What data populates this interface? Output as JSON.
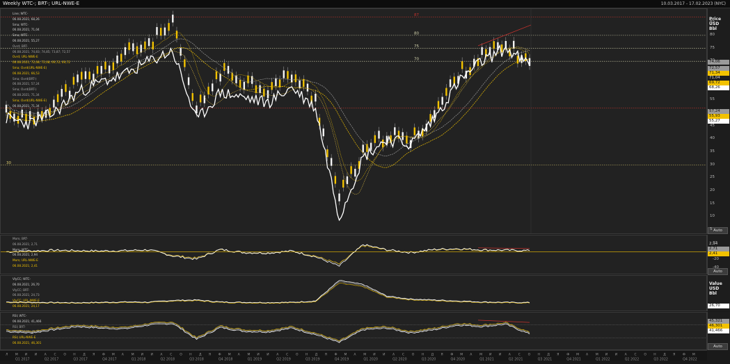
{
  "window": {
    "title": "Weekly WTC-; BRT-; URL-NWE-E",
    "range": "10.03.2017 - 17.02.2023 (NYC)"
  },
  "colors": {
    "gold": "#f2c200",
    "white": "#ffffff",
    "red": "#c8322d",
    "grey": "#9a9a9a",
    "bg": "#222222"
  },
  "main_axis": {
    "title_lines": [
      "Price",
      "USD",
      "Bbl"
    ],
    "ticks": [
      "85",
      "80",
      "75",
      "70",
      "65",
      "60",
      "55",
      "50",
      "45",
      "40",
      "35",
      "30",
      "25",
      "20",
      "15",
      "10",
      "5"
    ],
    "auto": "Auto",
    "tags": [
      {
        "text": "74,06",
        "style": "grey"
      },
      {
        "text": "72,57",
        "style": "grey"
      },
      {
        "text": "71,34",
        "style": "gold"
      },
      {
        "text": "71,04",
        "style": "dark"
      },
      {
        "text": "69,72",
        "style": "gold"
      },
      {
        "text": "68,26",
        "style": "white"
      },
      {
        "text": "57,24",
        "style": "grey"
      },
      {
        "text": "55,93",
        "style": "gold"
      },
      {
        "text": "55,27",
        "style": "white"
      }
    ]
  },
  "levels": [
    {
      "label": "87",
      "value": 87,
      "color": "#c8322d"
    },
    {
      "label": "80",
      "value": 80,
      "color": "#d8d8b0"
    },
    {
      "label": "75",
      "value": 75,
      "color": "#d8d8b0"
    },
    {
      "label": "70",
      "value": 70,
      "color": "#d8d8b0"
    },
    {
      "label": "",
      "value": 52,
      "color": "#c8322d"
    },
    {
      "label": "30",
      "value": 30,
      "color": "#e0d070"
    }
  ],
  "main_legend": [
    {
      "t": "Line; WTC-",
      "c": ""
    },
    {
      "t": "06.08.2021; 68,26",
      "c": ""
    },
    {
      "t": "Sma; WTC-",
      "c": ""
    },
    {
      "t": "06.08.2021; 71,04",
      "c": ""
    },
    {
      "t": "Sma; WTC-",
      "c": ""
    },
    {
      "t": "06.08.2021; 55,27",
      "c": ""
    },
    {
      "t": "Ovrd; BRT-",
      "c": "g"
    },
    {
      "t": "06.08.2021; 74,83; 74,85; 73,87; 72,57",
      "c": "g"
    },
    {
      "t": "Ovrd; URL-NWE-E",
      "c": "y"
    },
    {
      "t": "06.08.2021; 72,08; 72,08; 69,72; 69,72",
      "c": "y"
    },
    {
      "t": "Sma; Ovrd(URL-NWE-E)",
      "c": "y"
    },
    {
      "t": "06.08.2021; 66,53",
      "c": "y"
    },
    {
      "t": "Sma; Ovrd(BRT-)",
      "c": "g"
    },
    {
      "t": "06.08.2021; 57,24",
      "c": "g"
    },
    {
      "t": "Sma; Ovrd(BRT-)",
      "c": "g"
    },
    {
      "t": "06.08.2021; 71,34",
      "c": "g"
    },
    {
      "t": "Sma; Ovrd(URL-NWE-E)",
      "c": "y"
    },
    {
      "t": "06.08.2021; 71,34",
      "c": ""
    }
  ],
  "mom_pane": {
    "legend": [
      {
        "t": "Mom; BRT-",
        "c": "g"
      },
      {
        "t": "06.08.2021; 2,71",
        "c": "g"
      },
      {
        "t": "Mom; WTC-",
        "c": ""
      },
      {
        "t": "06.08.2021; 2,94",
        "c": ""
      },
      {
        "t": "Mom; URL-NWE-E",
        "c": "y"
      },
      {
        "t": "06.08.2021; 2,41",
        "c": "y"
      }
    ],
    "ticks": [
      "20",
      "0",
      "-20",
      "-40"
    ],
    "tags": [
      {
        "text": "2,94",
        "style": "dark"
      },
      {
        "text": "2,71",
        "style": "grey"
      },
      {
        "text": "2,41",
        "style": "gold"
      }
    ],
    "auto": "Auto"
  },
  "vol_pane": {
    "legend": [
      {
        "t": "VlyCC; WTC-",
        "c": ""
      },
      {
        "t": "06.08.2021; 26,70",
        "c": ""
      },
      {
        "t": "VlyCC; BRT-",
        "c": "g"
      },
      {
        "t": "06.08.2021; 24,73",
        "c": "g"
      },
      {
        "t": "VlyCC; URL-NWE-E",
        "c": "y"
      },
      {
        "t": "06.08.2021; 24,17",
        "c": "y"
      }
    ],
    "title_lines": [
      "Value",
      "USD",
      "Bbl"
    ],
    "tags": [
      {
        "text": "26,70",
        "style": "white"
      }
    ],
    "auto": "Auto"
  },
  "rsi_pane": {
    "legend": [
      {
        "t": "RSI; WTC-",
        "c": ""
      },
      {
        "t": "06.08.2021; 41,466",
        "c": ""
      },
      {
        "t": "RSI; BRT-",
        "c": "g"
      },
      {
        "t": "06.08.2021; 45,321",
        "c": "g"
      },
      {
        "t": "RSI; URL-NWE-E",
        "c": "y"
      },
      {
        "t": "06.08.2021; 46,301",
        "c": "y"
      }
    ],
    "tags": [
      {
        "text": "45,321",
        "style": "grey"
      },
      {
        "text": "46,301",
        "style": "gold"
      },
      {
        "text": "41,466",
        "style": "white"
      }
    ],
    "auto": "Auto"
  },
  "date_axis": {
    "months": [
      "Л",
      "М",
      "И",
      "И",
      "А",
      "С",
      "О",
      "Н",
      "Д",
      "Я",
      "Ф",
      "М",
      "А",
      "М",
      "И",
      "И",
      "А",
      "С",
      "О",
      "Н",
      "Д",
      "Я",
      "Ф",
      "М",
      "А",
      "М",
      "И",
      "И",
      "А",
      "С",
      "О",
      "Н",
      "Д",
      "Я",
      "Ф",
      "М",
      "А",
      "М",
      "И",
      "И",
      "А",
      "С",
      "О",
      "Н",
      "Д",
      "Я",
      "Ф",
      "М",
      "А",
      "М",
      "И",
      "И",
      "А",
      "С",
      "О",
      "Н",
      "Д",
      "Я",
      "Ф",
      "М",
      "А",
      "М",
      "И",
      "И",
      "А",
      "С",
      "О",
      "Н",
      "Д",
      "Я",
      "Ф",
      "М"
    ],
    "quarters": [
      "Q1 2017",
      "Q2 2017",
      "Q3 2017",
      "Q4 2017",
      "Q1 2018",
      "Q2 2018",
      "Q3 2018",
      "Q4 2018",
      "Q1 2019",
      "Q2 2019",
      "Q3 2019",
      "Q4 2019",
      "Q1 2020",
      "Q2 2020",
      "Q3 2020",
      "Q4 2020",
      "Q1 2021",
      "Q2 2021",
      "Q3 2021",
      "Q4 2021",
      "Q1 2022",
      "Q2 2022",
      "Q3 2022",
      "Q4 2022",
      "Q1 2023"
    ]
  },
  "chart_data": {
    "type": "line",
    "title": "Weekly WTC-; BRT-; URL-NWE-E",
    "ylabel": "Price USD Bbl",
    "ylim": [
      5,
      88
    ],
    "x": [
      "2017-03",
      "2017-06",
      "2017-09",
      "2017-12",
      "2018-03",
      "2018-06",
      "2018-09",
      "2018-10",
      "2018-12",
      "2019-03",
      "2019-06",
      "2019-09",
      "2019-12",
      "2020-02",
      "2020-04",
      "2020-05",
      "2020-07",
      "2020-10",
      "2020-12",
      "2021-03",
      "2021-06",
      "2021-07",
      "2021-08"
    ],
    "series": [
      {
        "name": "WTC-",
        "values": [
          48,
          46,
          50,
          58,
          62,
          65,
          70,
          74,
          47,
          58,
          56,
          54,
          60,
          52,
          10,
          33,
          40,
          38,
          48,
          62,
          70,
          75,
          68.26
        ]
      },
      {
        "name": "BRT-",
        "values": [
          52,
          48,
          55,
          63,
          67,
          74,
          78,
          86,
          52,
          67,
          64,
          60,
          66,
          56,
          22,
          36,
          43,
          40,
          51,
          66,
          73,
          77,
          72.57
        ]
      },
      {
        "name": "URL-NWE-E",
        "values": [
          51,
          47,
          54,
          62,
          66,
          73,
          77,
          84,
          51,
          66,
          63,
          59,
          65,
          55,
          18,
          34,
          42,
          39,
          50,
          65,
          72,
          76,
          69.72
        ]
      }
    ],
    "levels": [
      87,
      80,
      75,
      70,
      52,
      30
    ],
    "legend": "top-left"
  }
}
